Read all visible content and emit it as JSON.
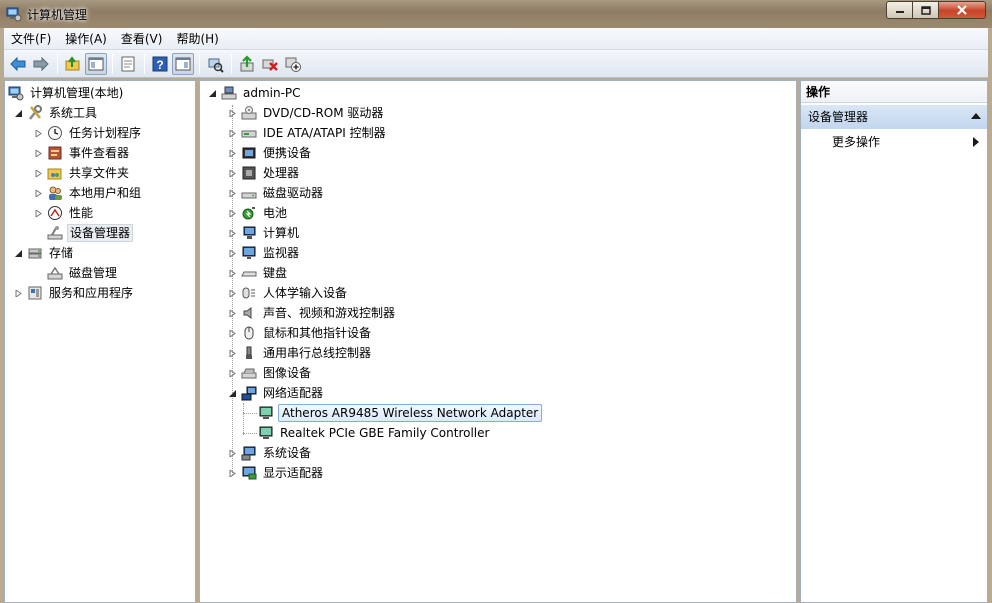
{
  "window": {
    "title": "计算机管理",
    "icon": "computer-management-icon"
  },
  "menu": [
    "文件(F)",
    "操作(A)",
    "查看(V)",
    "帮助(H)"
  ],
  "toolbar": [
    "back-arrow-icon",
    "forward-arrow-icon",
    "up-folder-icon",
    "show-hide-tree-icon",
    "properties-icon",
    "help-icon",
    "show-hide-action-pane-icon",
    "scan-hardware-icon",
    "update-driver-icon",
    "uninstall-icon",
    "disable-device-icon"
  ],
  "left_tree": {
    "root": "计算机管理(本地)",
    "system_tools": "系统工具",
    "items": [
      "任务计划程序",
      "事件查看器",
      "共享文件夹",
      "本地用户和组",
      "性能",
      "设备管理器"
    ],
    "storage": "存储",
    "disk_management": "磁盘管理",
    "services": "服务和应用程序"
  },
  "device_tree": {
    "root": "admin-PC",
    "categories": [
      "DVD/CD-ROM 驱动器",
      "IDE ATA/ATAPI 控制器",
      "便携设备",
      "处理器",
      "磁盘驱动器",
      "电池",
      "计算机",
      "监视器",
      "键盘",
      "人体学输入设备",
      "声音、视频和游戏控制器",
      "鼠标和其他指针设备",
      "通用串行总线控制器",
      "图像设备",
      "网络适配器"
    ],
    "network_children": [
      "Atheros AR9485 Wireless Network Adapter",
      "Realtek PCIe GBE Family Controller"
    ],
    "after": [
      "系统设备",
      "显示适配器"
    ]
  },
  "actions": {
    "header": "操作",
    "section": "设备管理器",
    "more": "更多操作"
  }
}
